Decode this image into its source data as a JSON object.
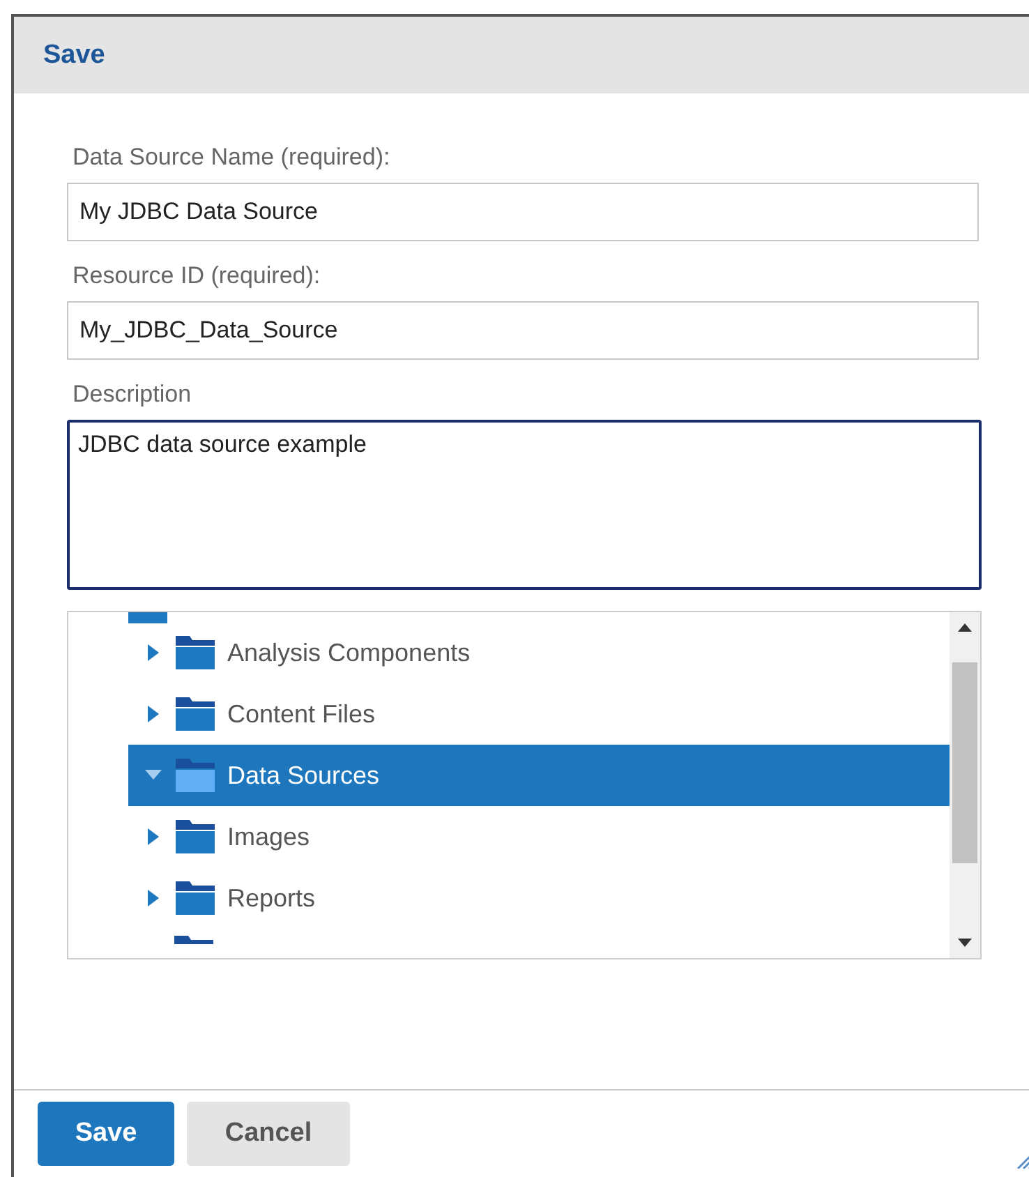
{
  "dialog": {
    "title": "Save"
  },
  "fields": [
    {
      "kind": "input",
      "label": "Data Source Name (required):",
      "value": "My JDBC Data Source"
    },
    {
      "kind": "input",
      "label": "Resource ID (required):",
      "value": "My_JDBC_Data_Source"
    },
    {
      "kind": "textarea",
      "label": "Description",
      "value": "JDBC data source example"
    }
  ],
  "tree": {
    "items": [
      {
        "label": "Analysis Components",
        "expanded": false,
        "selected": false
      },
      {
        "label": "Content Files",
        "expanded": false,
        "selected": false
      },
      {
        "label": "Data Sources",
        "expanded": true,
        "selected": true
      },
      {
        "label": "Images",
        "expanded": false,
        "selected": false
      },
      {
        "label": "Reports",
        "expanded": false,
        "selected": false
      }
    ]
  },
  "buttons": [
    {
      "label": "Save",
      "kind": "primary"
    },
    {
      "label": "Cancel",
      "kind": "secondary"
    }
  ]
}
